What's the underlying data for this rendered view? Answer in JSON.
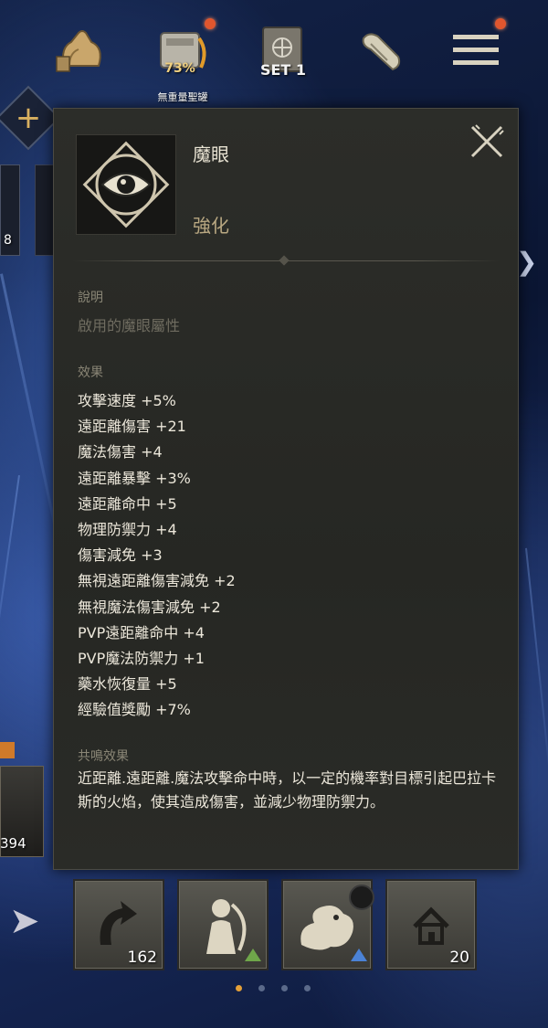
{
  "top_bar": {
    "inventory_percent": "73%",
    "set_label": "SET 1",
    "weight_label": "無重量聖罐"
  },
  "side_slot": {
    "count": "8"
  },
  "left_card": {
    "count": "394"
  },
  "tooltip": {
    "name": "魔眼",
    "type": "強化",
    "description_title": "說明",
    "description_text": "啟用的魔眼屬性",
    "effects_title": "效果",
    "effects": [
      "攻擊速度 +5%",
      "遠距離傷害 +21",
      "魔法傷害 +4",
      "遠距離暴擊 +3%",
      "遠距離命中 +5",
      "物理防禦力 +4",
      "傷害減免 +3",
      "無視遠距離傷害減免 +2",
      "無視魔法傷害減免 +2",
      "PVP遠距離命中 +4",
      "PVP魔法防禦力 +1",
      "藥水恢復量 +5",
      "經驗值獎勵 +7%"
    ],
    "resonance_title": "共鳴效果",
    "resonance_text": "近距離.遠距離.魔法攻擊命中時，以一定的機率對目標引起巴拉卡斯的火焰，使其造成傷害，並減少物理防禦力。"
  },
  "bottom_cards": [
    {
      "name": "return-scroll",
      "count": "162"
    },
    {
      "name": "character-card-green",
      "count": ""
    },
    {
      "name": "dragon-card-blue",
      "count": ""
    },
    {
      "name": "home-scroll",
      "count": "20"
    }
  ],
  "pager": {
    "pages": 4,
    "active": 1
  },
  "colors": {
    "panel_bg": "#2a2b27",
    "accent_gold": "#b9a882",
    "dim_text": "#6f6c60",
    "text": "#ece7da",
    "green_arrow": "#6fa64a",
    "blue_arrow": "#4b82d6",
    "pager_active": "#e5a038"
  }
}
